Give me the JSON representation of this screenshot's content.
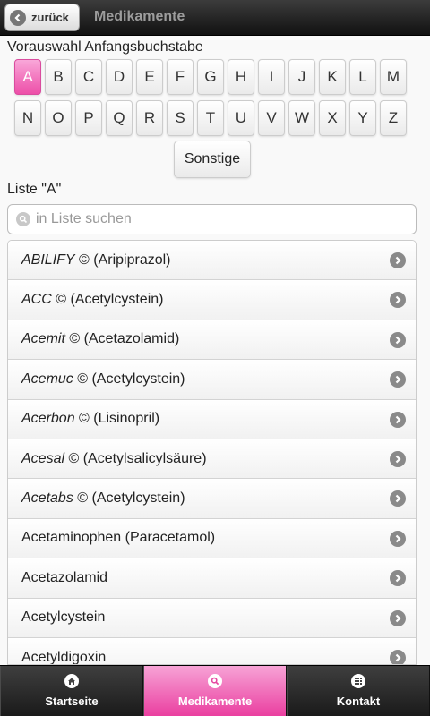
{
  "header": {
    "back_label": "zurück",
    "title": "Medikamente"
  },
  "preselect_label": "Vorauswahl Anfangsbuchstabe",
  "letters_row1": [
    "A",
    "B",
    "C",
    "D",
    "E",
    "F",
    "G",
    "H",
    "I",
    "J",
    "K",
    "L",
    "M"
  ],
  "letters_row2": [
    "N",
    "O",
    "P",
    "Q",
    "R",
    "S",
    "T",
    "U",
    "V",
    "W",
    "X",
    "Y",
    "Z"
  ],
  "active_letter": "A",
  "other_label": "Sonstige",
  "list_title": "Liste \"A\"",
  "search": {
    "placeholder": "in Liste suchen"
  },
  "items": [
    {
      "brand": "ABILIFY",
      "rest": " © (Aripiprazol)"
    },
    {
      "brand": "ACC",
      "rest": " © (Acetylcystein)"
    },
    {
      "brand": "Acemit",
      "rest": " © (Acetazolamid)"
    },
    {
      "brand": "Acemuc",
      "rest": " © (Acetylcystein)"
    },
    {
      "brand": "Acerbon",
      "rest": " © (Lisinopril)"
    },
    {
      "brand": "Acesal",
      "rest": " © (Acetylsalicylsäure)"
    },
    {
      "brand": "Acetabs",
      "rest": " © (Acetylcystein)"
    },
    {
      "brand": "",
      "rest": "Acetaminophen (Paracetamol)"
    },
    {
      "brand": "",
      "rest": "Acetazolamid"
    },
    {
      "brand": "",
      "rest": "Acetylcystein"
    },
    {
      "brand": "",
      "rest": "Acetyldigoxin"
    }
  ],
  "tabs": [
    {
      "label": "Startseite",
      "icon": "home-icon",
      "active": false
    },
    {
      "label": "Medikamente",
      "icon": "search-icon",
      "active": true
    },
    {
      "label": "Kontakt",
      "icon": "grid-icon",
      "active": false
    }
  ],
  "colors": {
    "accent": "#ed4ea8",
    "header": "#1a1a1a"
  }
}
